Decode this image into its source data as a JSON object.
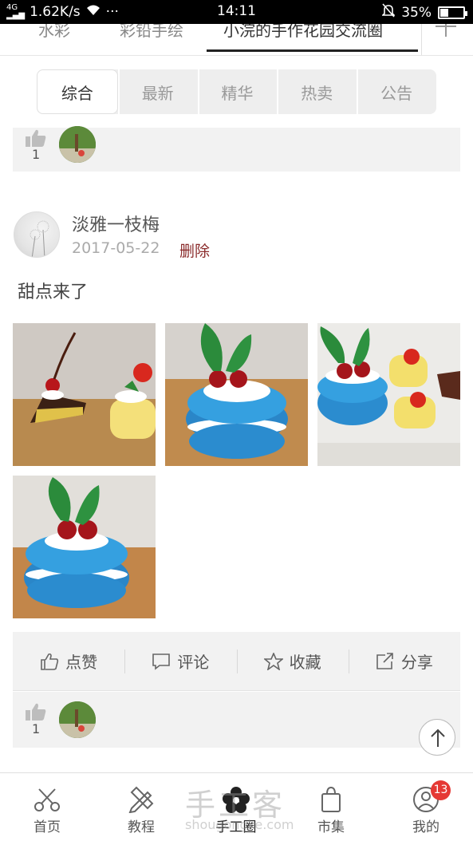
{
  "status_bar": {
    "network": "4G",
    "speed": "1.62K/s",
    "dots": "···",
    "time": "14:11",
    "battery": "35%",
    "battery_level": 0.35
  },
  "top_tabs": [
    {
      "label": "水彩"
    },
    {
      "label": "彩铅手绘"
    },
    {
      "label": "小浣的手作花园交流圈",
      "active": true
    }
  ],
  "segments": [
    {
      "label": "综合",
      "active": true
    },
    {
      "label": "最新"
    },
    {
      "label": "精华"
    },
    {
      "label": "热卖"
    },
    {
      "label": "公告"
    }
  ],
  "prev_post_likes": {
    "count": "1"
  },
  "post": {
    "username": "淡雅一枝梅",
    "date": "2017-05-22",
    "delete_label": "删除",
    "content": "甜点来了",
    "photos": [
      {
        "icon": "cake-cherry-photo"
      },
      {
        "icon": "macaron-photo"
      },
      {
        "icon": "macaron-rolls-photo"
      },
      {
        "icon": "macaron-photo-2"
      }
    ],
    "actions": {
      "like": "点赞",
      "comment": "评论",
      "favorite": "收藏",
      "share": "分享"
    },
    "likes": {
      "count": "1"
    }
  },
  "bottom_nav": [
    {
      "label": "首页",
      "icon": "scissors-icon"
    },
    {
      "label": "教程",
      "icon": "pencil-ruler-icon"
    },
    {
      "label": "手工圈",
      "icon": "flower-icon",
      "active": true
    },
    {
      "label": "市集",
      "icon": "shopping-bag-icon"
    },
    {
      "label": "我的",
      "icon": "user-icon"
    }
  ],
  "badge": "13",
  "watermark": {
    "title": "手工客",
    "url": "shougongke.com"
  },
  "colors": {
    "accent_delete": "#8a2a2a",
    "badge": "#e53935",
    "panel": "#f2f2f2"
  }
}
